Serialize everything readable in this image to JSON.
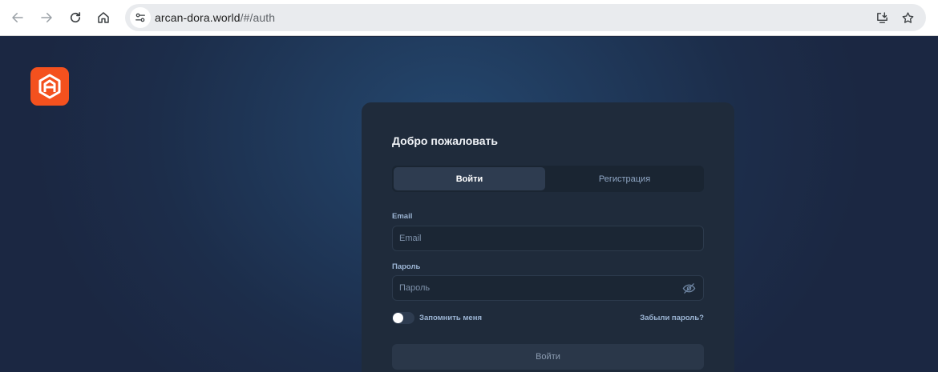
{
  "browser": {
    "url_host": "arcan-dora.world",
    "url_path": "/#/auth",
    "icons": [
      "back-arrow-icon",
      "forward-arrow-icon",
      "reload-icon",
      "home-icon",
      "site-info-icon",
      "install-app-icon",
      "bookmark-star-icon"
    ]
  },
  "brand": {
    "logo_icon": "arcan-logo-icon",
    "accent": "#f4511e"
  },
  "auth": {
    "title": "Добро пожаловать",
    "tabs": [
      {
        "label": "Войти",
        "active": true
      },
      {
        "label": "Регистрация",
        "active": false
      }
    ],
    "email": {
      "label": "Email",
      "placeholder": "Email",
      "value": ""
    },
    "password": {
      "label": "Пароль",
      "placeholder": "Пароль",
      "value": "",
      "toggle_icon": "eye-off-icon"
    },
    "remember": {
      "label": "Запомнить меня",
      "checked": false
    },
    "forgot_label": "Забыли пароль?",
    "submit_label": "Войти"
  }
}
